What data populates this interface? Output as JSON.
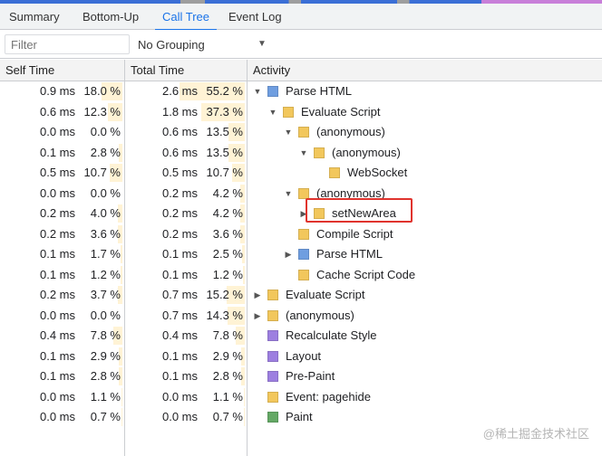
{
  "tabs": [
    {
      "label": "Summary",
      "active": false
    },
    {
      "label": "Bottom-Up",
      "active": false
    },
    {
      "label": "Call Tree",
      "active": true
    },
    {
      "label": "Event Log",
      "active": false
    }
  ],
  "toolbar": {
    "filter_placeholder": "Filter",
    "grouping": "No Grouping"
  },
  "columns": {
    "self": "Self Time",
    "total": "Total Time",
    "activity": "Activity"
  },
  "colors": {
    "script": "#f2c75c",
    "layout": "#9d7fe0",
    "paint": "#64a865",
    "html": "#6f9ee0",
    "accent": "#1a73e8",
    "highlight": "#e0332d",
    "bar": "#fff3d5"
  },
  "rows": [
    {
      "self_ms": "0.9 ms",
      "self_pct": "18.0 %",
      "self_frac": 0.18,
      "total_ms": "2.6 ms",
      "total_pct": "55.2 %",
      "total_frac": 0.552,
      "depth": 0,
      "toggle": "open",
      "color": "html",
      "name": "Parse HTML"
    },
    {
      "self_ms": "0.6 ms",
      "self_pct": "12.3 %",
      "self_frac": 0.123,
      "total_ms": "1.8 ms",
      "total_pct": "37.3 %",
      "total_frac": 0.373,
      "depth": 1,
      "toggle": "open",
      "color": "script",
      "name": "Evaluate Script"
    },
    {
      "self_ms": "0.0 ms",
      "self_pct": "0.0 %",
      "self_frac": 0,
      "total_ms": "0.6 ms",
      "total_pct": "13.5 %",
      "total_frac": 0.135,
      "depth": 2,
      "toggle": "open",
      "color": "script",
      "name": "(anonymous)"
    },
    {
      "self_ms": "0.1 ms",
      "self_pct": "2.8 %",
      "self_frac": 0.028,
      "total_ms": "0.6 ms",
      "total_pct": "13.5 %",
      "total_frac": 0.135,
      "depth": 3,
      "toggle": "open",
      "color": "script",
      "name": "(anonymous)"
    },
    {
      "self_ms": "0.5 ms",
      "self_pct": "10.7 %",
      "self_frac": 0.107,
      "total_ms": "0.5 ms",
      "total_pct": "10.7 %",
      "total_frac": 0.107,
      "depth": 4,
      "toggle": "none",
      "color": "script",
      "name": "WebSocket"
    },
    {
      "self_ms": "0.0 ms",
      "self_pct": "0.0 %",
      "self_frac": 0,
      "total_ms": "0.2 ms",
      "total_pct": "4.2 %",
      "total_frac": 0.042,
      "depth": 2,
      "toggle": "open",
      "color": "script",
      "name": "(anonymous)"
    },
    {
      "self_ms": "0.2 ms",
      "self_pct": "4.0 %",
      "self_frac": 0.04,
      "total_ms": "0.2 ms",
      "total_pct": "4.2 %",
      "total_frac": 0.042,
      "depth": 3,
      "toggle": "closed",
      "color": "script",
      "name": "setNewArea"
    },
    {
      "self_ms": "0.2 ms",
      "self_pct": "3.6 %",
      "self_frac": 0.036,
      "total_ms": "0.2 ms",
      "total_pct": "3.6 %",
      "total_frac": 0.036,
      "depth": 2,
      "toggle": "none",
      "color": "script",
      "name": "Compile Script"
    },
    {
      "self_ms": "0.1 ms",
      "self_pct": "1.7 %",
      "self_frac": 0.017,
      "total_ms": "0.1 ms",
      "total_pct": "2.5 %",
      "total_frac": 0.025,
      "depth": 2,
      "toggle": "closed",
      "color": "html",
      "name": "Parse HTML"
    },
    {
      "self_ms": "0.1 ms",
      "self_pct": "1.2 %",
      "self_frac": 0.012,
      "total_ms": "0.1 ms",
      "total_pct": "1.2 %",
      "total_frac": 0.012,
      "depth": 2,
      "toggle": "none",
      "color": "script",
      "name": "Cache Script Code"
    },
    {
      "self_ms": "0.2 ms",
      "self_pct": "3.7 %",
      "self_frac": 0.037,
      "total_ms": "0.7 ms",
      "total_pct": "15.2 %",
      "total_frac": 0.152,
      "depth": 0,
      "toggle": "closed",
      "color": "script",
      "name": "Evaluate Script"
    },
    {
      "self_ms": "0.0 ms",
      "self_pct": "0.0 %",
      "self_frac": 0,
      "total_ms": "0.7 ms",
      "total_pct": "14.3 %",
      "total_frac": 0.143,
      "depth": 0,
      "toggle": "closed",
      "color": "script",
      "name": "(anonymous)"
    },
    {
      "self_ms": "0.4 ms",
      "self_pct": "7.8 %",
      "self_frac": 0.078,
      "total_ms": "0.4 ms",
      "total_pct": "7.8 %",
      "total_frac": 0.078,
      "depth": 0,
      "toggle": "none",
      "color": "layout",
      "name": "Recalculate Style"
    },
    {
      "self_ms": "0.1 ms",
      "self_pct": "2.9 %",
      "self_frac": 0.029,
      "total_ms": "0.1 ms",
      "total_pct": "2.9 %",
      "total_frac": 0.029,
      "depth": 0,
      "toggle": "none",
      "color": "layout",
      "name": "Layout"
    },
    {
      "self_ms": "0.1 ms",
      "self_pct": "2.8 %",
      "self_frac": 0.028,
      "total_ms": "0.1 ms",
      "total_pct": "2.8 %",
      "total_frac": 0.028,
      "depth": 0,
      "toggle": "none",
      "color": "layout",
      "name": "Pre-Paint"
    },
    {
      "self_ms": "0.0 ms",
      "self_pct": "1.1 %",
      "self_frac": 0.011,
      "total_ms": "0.0 ms",
      "total_pct": "1.1 %",
      "total_frac": 0.011,
      "depth": 0,
      "toggle": "none",
      "color": "script",
      "name": "Event: pagehide"
    },
    {
      "self_ms": "0.0 ms",
      "self_pct": "0.7 %",
      "self_frac": 0.007,
      "total_ms": "0.0 ms",
      "total_pct": "0.7 %",
      "total_frac": 0.007,
      "depth": 0,
      "toggle": "none",
      "color": "paint",
      "name": "Paint"
    }
  ],
  "watermark": "@稀土掘金技术社区"
}
